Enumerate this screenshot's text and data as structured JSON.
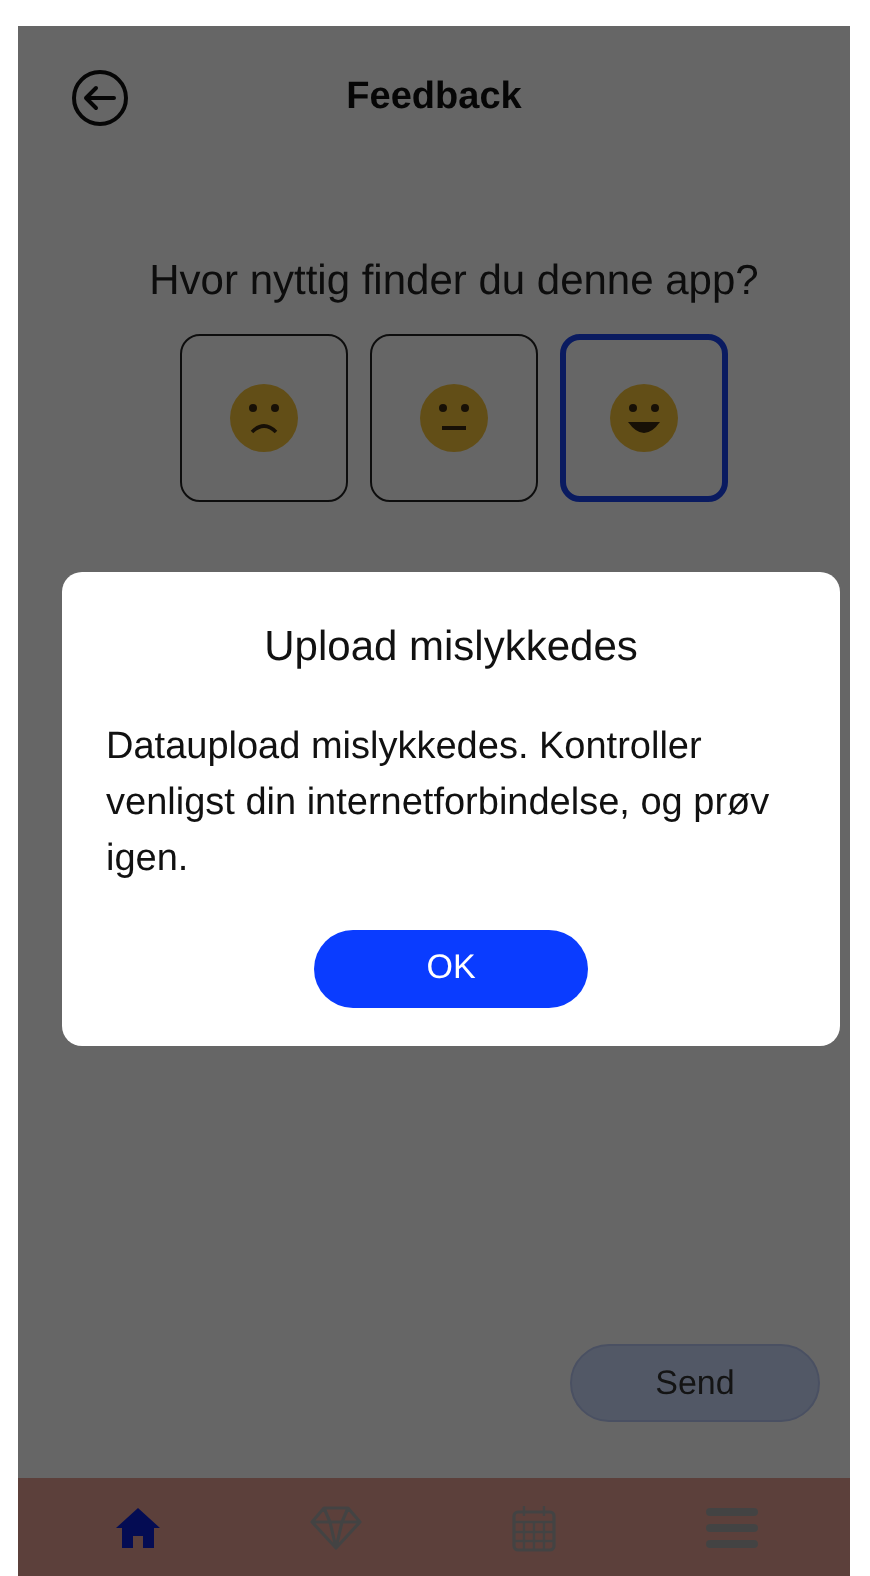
{
  "header": {
    "title": "Feedback"
  },
  "question": "Hvor nyttig finder du denne app?",
  "ratings": [
    {
      "kind": "sad",
      "selected": false
    },
    {
      "kind": "neutral",
      "selected": false
    },
    {
      "kind": "happy",
      "selected": true
    }
  ],
  "send_button": "Send",
  "nav": [
    {
      "kind": "home",
      "selected": true
    },
    {
      "kind": "diamond",
      "selected": false
    },
    {
      "kind": "calendar",
      "selected": false
    },
    {
      "kind": "menu",
      "selected": false
    }
  ],
  "dialog": {
    "title": "Upload mislykkedes",
    "message": "Dataupload mislykkedes. Kontroller venligst din internetforbindelse, og prøv igen.",
    "button": "OK"
  }
}
